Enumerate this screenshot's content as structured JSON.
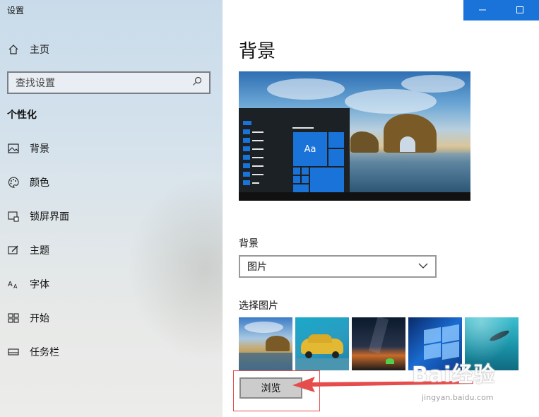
{
  "window": {
    "title": "设置",
    "minimize_icon": "minimize-icon",
    "maximize_icon": "maximize-icon",
    "accent_color": "#1a73d8"
  },
  "sidebar": {
    "home_label": "主页",
    "search_placeholder": "查找设置",
    "section_title": "个性化",
    "items": [
      {
        "label": "背景",
        "icon": "image-icon"
      },
      {
        "label": "颜色",
        "icon": "palette-icon"
      },
      {
        "label": "锁屏界面",
        "icon": "lock-screen-icon"
      },
      {
        "label": "主题",
        "icon": "theme-icon"
      },
      {
        "label": "字体",
        "icon": "font-icon"
      },
      {
        "label": "开始",
        "icon": "start-icon"
      },
      {
        "label": "任务栏",
        "icon": "taskbar-icon"
      }
    ]
  },
  "main": {
    "page_title": "背景",
    "preview_tile_text": "Aa",
    "background_label": "背景",
    "background_select_value": "图片",
    "choose_picture_label": "选择图片",
    "browse_label": "浏览"
  },
  "annotation": {
    "highlight_color": "#e64c4c"
  },
  "watermark": {
    "text": "Bai经验",
    "sub": "jingyan.baidu.com"
  }
}
